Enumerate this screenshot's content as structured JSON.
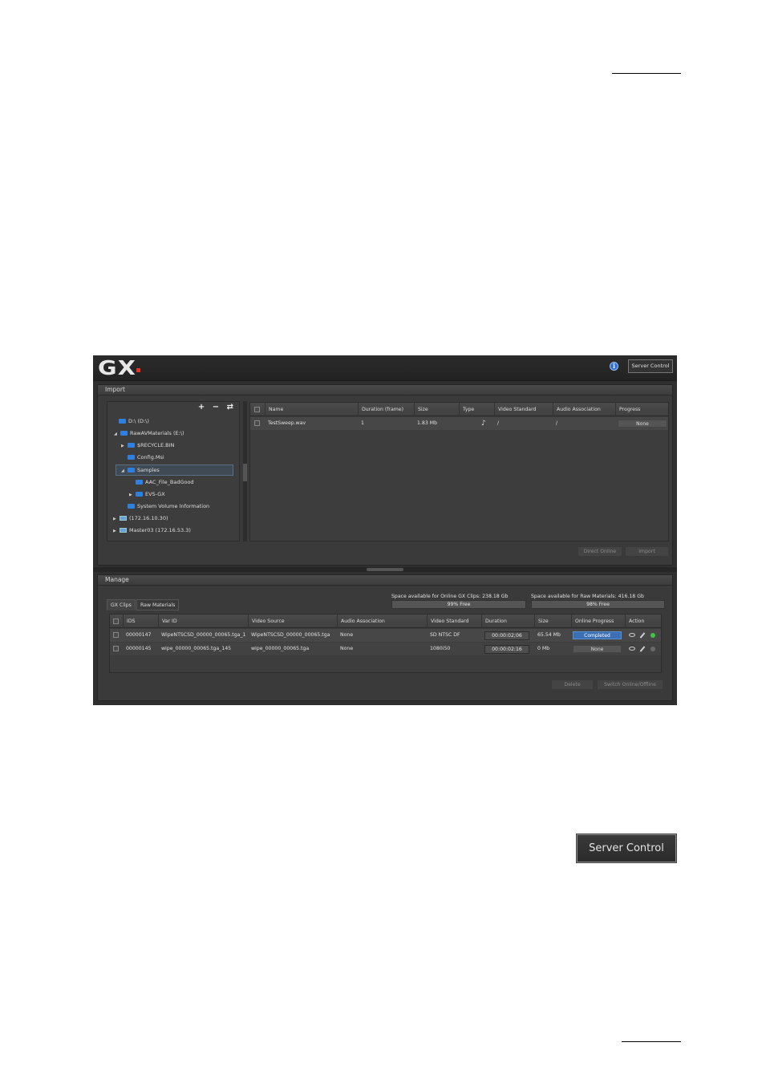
{
  "app": {
    "logo": "GX",
    "server_control_label": "Server Control"
  },
  "import": {
    "title": "Import",
    "tree_tools": "+ − ⇄",
    "tree": [
      {
        "label": "D:\\  (D:\\)",
        "type": "drive"
      },
      {
        "label": "RawAVMaterials  (E:\\)",
        "type": "drive"
      },
      {
        "label": "$RECYCLE.BIN",
        "type": "folder"
      },
      {
        "label": "Config.Msi",
        "type": "folder"
      },
      {
        "label": "Samples",
        "type": "folder"
      },
      {
        "label": "AAC_File_BadGood",
        "type": "folder"
      },
      {
        "label": "EVS-GX",
        "type": "folder"
      },
      {
        "label": "System Volume Information",
        "type": "folder"
      },
      {
        "label": "(172.16.10.30)",
        "type": "network"
      },
      {
        "label": "Master03  (172.16.53.3)",
        "type": "network"
      }
    ],
    "columns": [
      "Name",
      "Duration (frame)",
      "Size",
      "Type",
      "Video Standard",
      "Audio Association",
      "Progress"
    ],
    "rows": [
      {
        "name": "TestSweep.wav",
        "duration": "1",
        "size": "1.83 Mb",
        "type_icon": "music-note-icon",
        "video_standard": "/",
        "audio_association": "/",
        "progress": "None"
      }
    ],
    "direct_online_label": "Direct Online",
    "import_label": "Import"
  },
  "manage": {
    "title": "Manage",
    "tabs": [
      "GX Clips",
      "Raw Materials"
    ],
    "space_gx_label": "Space available for Online GX Clips: 238.18 Gb",
    "space_gx_bar": "99% Free",
    "space_raw_label": "Space available for Raw Materials: 416.18 Gb",
    "space_raw_bar": "98% Free",
    "space_gx_free": 0.99,
    "space_raw_free": 0.98,
    "columns": [
      "IDS",
      "Var ID",
      "Video Source",
      "Audio Association",
      "Video Standard",
      "Duration",
      "Size",
      "Online Progress",
      "Action"
    ],
    "rows": [
      {
        "ids": "00000147",
        "var_id": "WipeNTSCSD_00000_00065.tga_1",
        "video_source": "WipeNTSCSD_00000_00065.tga",
        "audio": "None",
        "standard": "SD NTSC DF",
        "duration": "00:00:02;06",
        "size": "65.54 Mb",
        "progress": "Completed",
        "status_color": "#3cc83c"
      },
      {
        "ids": "00000145",
        "var_id": "wipe_00000_00065.tga_145",
        "video_source": "wipe_00000_00065.tga",
        "audio": "None",
        "standard": "1080i50",
        "duration": "00:00:02:16",
        "size": "0 Mb",
        "progress": "None",
        "status_color": "#6a6a6a"
      }
    ],
    "delete_label": "Delete",
    "switch_label": "Switch Online/Offline"
  },
  "server_control_button": "Server Control"
}
